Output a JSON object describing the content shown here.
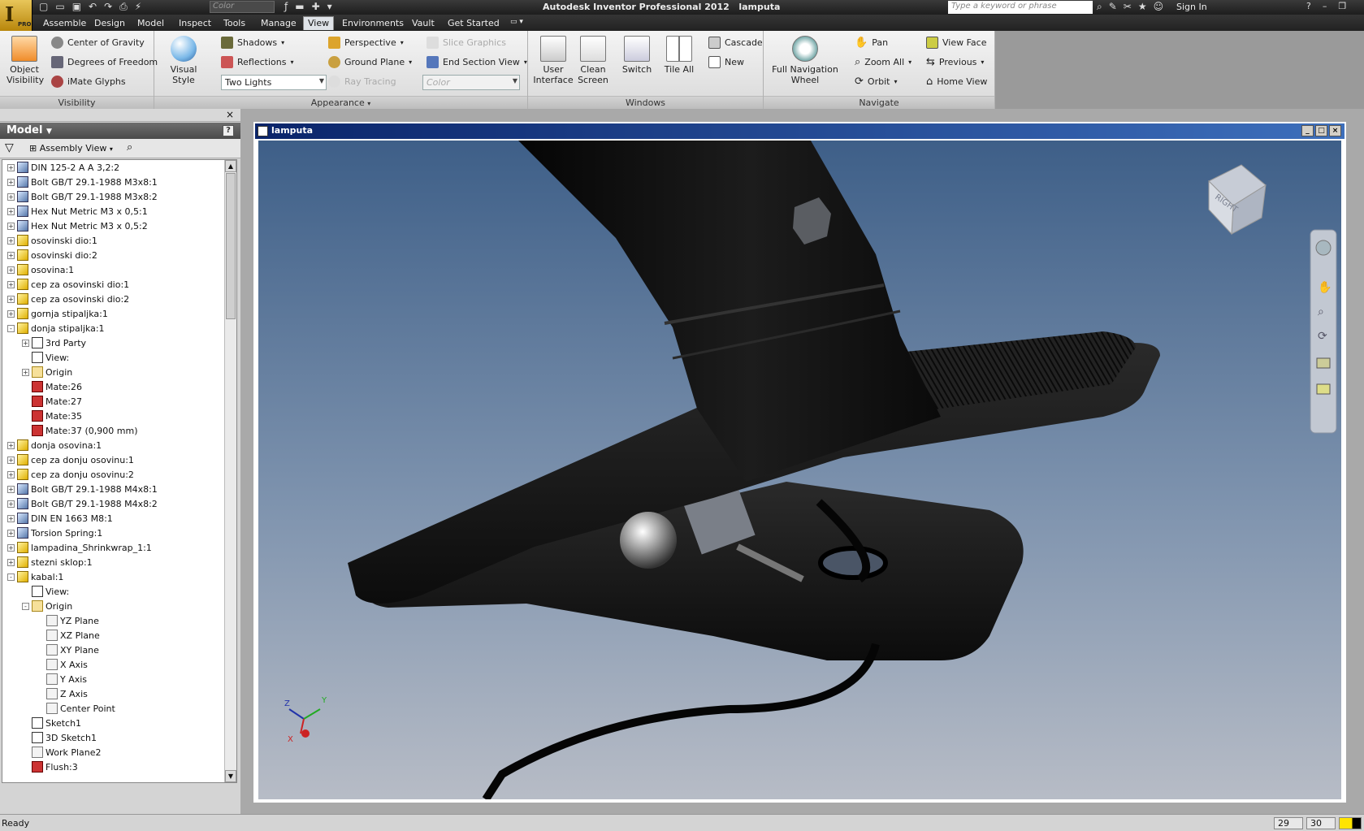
{
  "title_bar": {
    "app_title": "Autodesk Inventor Professional 2012",
    "doc_name": "lamputa",
    "qa_color_placeholder": "Color",
    "search_placeholder": "Type a keyword or phrase",
    "sign_in": "Sign In",
    "pro_badge": "PRO"
  },
  "tabs": [
    "Assemble",
    "Design",
    "Model",
    "Inspect",
    "Tools",
    "Manage",
    "View",
    "Environments",
    "Vault",
    "Get Started"
  ],
  "active_tab": "View",
  "ribbon": {
    "visibility": {
      "title": "Visibility",
      "object_visibility": "Object\nVisibility",
      "center_of_gravity": "Center of Gravity",
      "degrees_of_freedom": "Degrees of Freedom",
      "imate_glyphs": "iMate Glyphs"
    },
    "appearance": {
      "title": "Appearance",
      "visual_style": "Visual Style",
      "shadows": "Shadows",
      "reflections": "Reflections",
      "lighting": "Two Lights",
      "perspective": "Perspective",
      "ground_plane": "Ground Plane",
      "ray_tracing": "Ray Tracing",
      "slice_graphics": "Slice Graphics",
      "end_section_view": "End Section View",
      "color": "Color"
    },
    "windows": {
      "title": "Windows",
      "user_interface": "User\nInterface",
      "clean_screen": "Clean\nScreen",
      "switch": "Switch",
      "tile_all": "Tile All",
      "cascade": "Cascade",
      "new": "New"
    },
    "navigate": {
      "title": "Navigate",
      "full_nav_wheel": "Full Navigation\nWheel",
      "pan": "Pan",
      "zoom_all": "Zoom All",
      "orbit": "Orbit",
      "view_face": "View Face",
      "previous": "Previous",
      "home_view": "Home View"
    }
  },
  "browser": {
    "header": "Model",
    "view_selector": "Assembly View",
    "tree": [
      {
        "label": "DIN 125-2 A A 3,2:2",
        "level": 0,
        "icon": "std",
        "exp": "+"
      },
      {
        "label": "Bolt GB/T 29.1-1988 M3x8:1",
        "level": 0,
        "icon": "std",
        "exp": "+"
      },
      {
        "label": "Bolt GB/T 29.1-1988 M3x8:2",
        "level": 0,
        "icon": "std",
        "exp": "+"
      },
      {
        "label": "Hex Nut Metric M3 x 0,5:1",
        "level": 0,
        "icon": "std",
        "exp": "+"
      },
      {
        "label": "Hex Nut Metric M3 x 0,5:2",
        "level": 0,
        "icon": "std",
        "exp": "+"
      },
      {
        "label": "osovinski dio:1",
        "level": 0,
        "icon": "part",
        "exp": "+"
      },
      {
        "label": "osovinski dio:2",
        "level": 0,
        "icon": "part",
        "exp": "+"
      },
      {
        "label": "osovina:1",
        "level": 0,
        "icon": "part",
        "exp": "+"
      },
      {
        "label": "cep za osovinski dio:1",
        "level": 0,
        "icon": "part",
        "exp": "+"
      },
      {
        "label": "cep za osovinski dio:2",
        "level": 0,
        "icon": "part",
        "exp": "+"
      },
      {
        "label": "gornja stipaljka:1",
        "level": 0,
        "icon": "part",
        "exp": "+"
      },
      {
        "label": "donja stipaljka:1",
        "level": 0,
        "icon": "part",
        "exp": "-"
      },
      {
        "label": "3rd Party",
        "level": 1,
        "icon": "sk",
        "exp": "+"
      },
      {
        "label": "View:",
        "level": 1,
        "icon": "sk",
        "exp": ""
      },
      {
        "label": "Origin",
        "level": 1,
        "icon": "folder",
        "exp": "+"
      },
      {
        "label": "Mate:26",
        "level": 1,
        "icon": "mate",
        "exp": ""
      },
      {
        "label": "Mate:27",
        "level": 1,
        "icon": "mate",
        "exp": ""
      },
      {
        "label": "Mate:35",
        "level": 1,
        "icon": "mate",
        "exp": ""
      },
      {
        "label": "Mate:37 (0,900 mm)",
        "level": 1,
        "icon": "mate",
        "exp": ""
      },
      {
        "label": "donja osovina:1",
        "level": 0,
        "icon": "part",
        "exp": "+"
      },
      {
        "label": "cep za donju osovinu:1",
        "level": 0,
        "icon": "part",
        "exp": "+"
      },
      {
        "label": "cep za donju osovinu:2",
        "level": 0,
        "icon": "part",
        "exp": "+"
      },
      {
        "label": "Bolt GB/T 29.1-1988 M4x8:1",
        "level": 0,
        "icon": "std",
        "exp": "+"
      },
      {
        "label": "Bolt GB/T 29.1-1988 M4x8:2",
        "level": 0,
        "icon": "std",
        "exp": "+"
      },
      {
        "label": "DIN EN 1663 M8:1",
        "level": 0,
        "icon": "std",
        "exp": "+"
      },
      {
        "label": "Torsion Spring:1",
        "level": 0,
        "icon": "std",
        "exp": "+"
      },
      {
        "label": "lampadina_Shrinkwrap_1:1",
        "level": 0,
        "icon": "part",
        "exp": "+"
      },
      {
        "label": "stezni sklop:1",
        "level": 0,
        "icon": "part",
        "exp": "+"
      },
      {
        "label": "kabal:1",
        "level": 0,
        "icon": "part",
        "exp": "-"
      },
      {
        "label": "View:",
        "level": 1,
        "icon": "sk",
        "exp": ""
      },
      {
        "label": "Origin",
        "level": 1,
        "icon": "folder",
        "exp": "-"
      },
      {
        "label": "YZ Plane",
        "level": 2,
        "icon": "plane",
        "exp": ""
      },
      {
        "label": "XZ Plane",
        "level": 2,
        "icon": "plane",
        "exp": ""
      },
      {
        "label": "XY Plane",
        "level": 2,
        "icon": "plane",
        "exp": ""
      },
      {
        "label": "X Axis",
        "level": 2,
        "icon": "plane",
        "exp": ""
      },
      {
        "label": "Y Axis",
        "level": 2,
        "icon": "plane",
        "exp": ""
      },
      {
        "label": "Z Axis",
        "level": 2,
        "icon": "plane",
        "exp": ""
      },
      {
        "label": "Center Point",
        "level": 2,
        "icon": "plane",
        "exp": ""
      },
      {
        "label": "Sketch1",
        "level": 1,
        "icon": "sk",
        "exp": ""
      },
      {
        "label": "3D Sketch1",
        "level": 1,
        "icon": "sk",
        "exp": ""
      },
      {
        "label": "Work Plane2",
        "level": 1,
        "icon": "plane",
        "exp": ""
      },
      {
        "label": "Flush:3",
        "level": 1,
        "icon": "mate",
        "exp": ""
      }
    ]
  },
  "graphics": {
    "window_title": "lamputa",
    "viewcube_face": "RIGHT",
    "triad": {
      "x": "X",
      "y": "Y",
      "z": "Z"
    }
  },
  "status": {
    "text": "Ready",
    "box1": "29",
    "box2": "30"
  },
  "colors": {
    "accent_title": "#0a246a",
    "viewport_top": "#3e5f88",
    "viewport_bottom": "#b7bcc6"
  }
}
